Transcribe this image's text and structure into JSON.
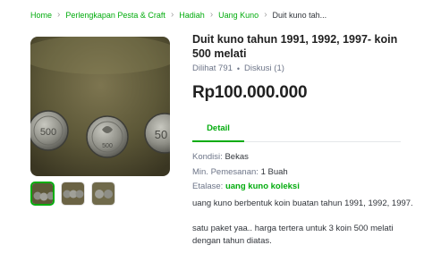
{
  "breadcrumb": {
    "items": [
      "Home",
      "Perlengkapan Pesta & Craft",
      "Hadiah",
      "Uang Kuno"
    ],
    "current": "Duit kuno tah..."
  },
  "product": {
    "title": "Duit kuno tahun 1991, 1992, 1997- koin 500 melati",
    "views": "Dilihat 791",
    "discussion": "Diskusi (1)",
    "price": "Rp100.000.000"
  },
  "images": {
    "main_icon": "coins-photo",
    "thumb_count": 3,
    "active_thumb": 0
  },
  "tabs": {
    "detail": "Detail"
  },
  "info": {
    "condition_label": "Kondisi:",
    "condition_value": "Bekas",
    "min_order_label": "Min. Pemesanan:",
    "min_order_value": "1 Buah",
    "showcase_label": "Etalase:",
    "showcase_value": "uang kuno koleksi"
  },
  "description": {
    "para1": "uang kuno berbentuk koin buatan tahun 1991, 1992, 1997.",
    "para2": "satu paket yaa.. harga tertera untuk 3 koin 500 melati dengan tahun diatas."
  },
  "colors": {
    "accent": "#03ac0e",
    "text": "#212121",
    "muted": "#6d7588"
  }
}
